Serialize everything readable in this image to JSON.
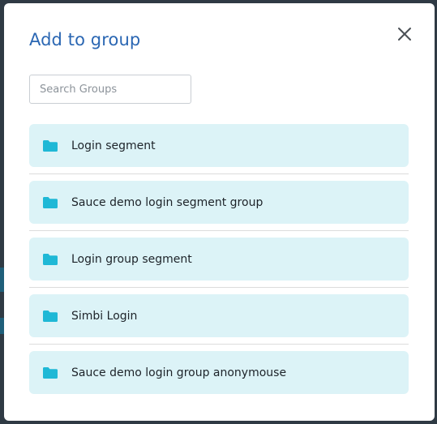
{
  "dialog": {
    "title": "Add to group",
    "close_icon": "close-icon"
  },
  "search": {
    "placeholder": "Search Groups",
    "value": ""
  },
  "groups": [
    {
      "label": "Login segment",
      "icon": "folder-icon"
    },
    {
      "label": "Sauce demo login segment group",
      "icon": "folder-icon"
    },
    {
      "label": "Login group segment",
      "icon": "folder-icon"
    },
    {
      "label": "Simbi Login",
      "icon": "folder-icon"
    },
    {
      "label": "Sauce demo login group anonymouse",
      "icon": "folder-icon"
    }
  ],
  "colors": {
    "title": "#2b67b3",
    "item_background": "#dcf3f7",
    "folder_icon": "#1fb8d6",
    "overlay": "#2f3a44"
  }
}
